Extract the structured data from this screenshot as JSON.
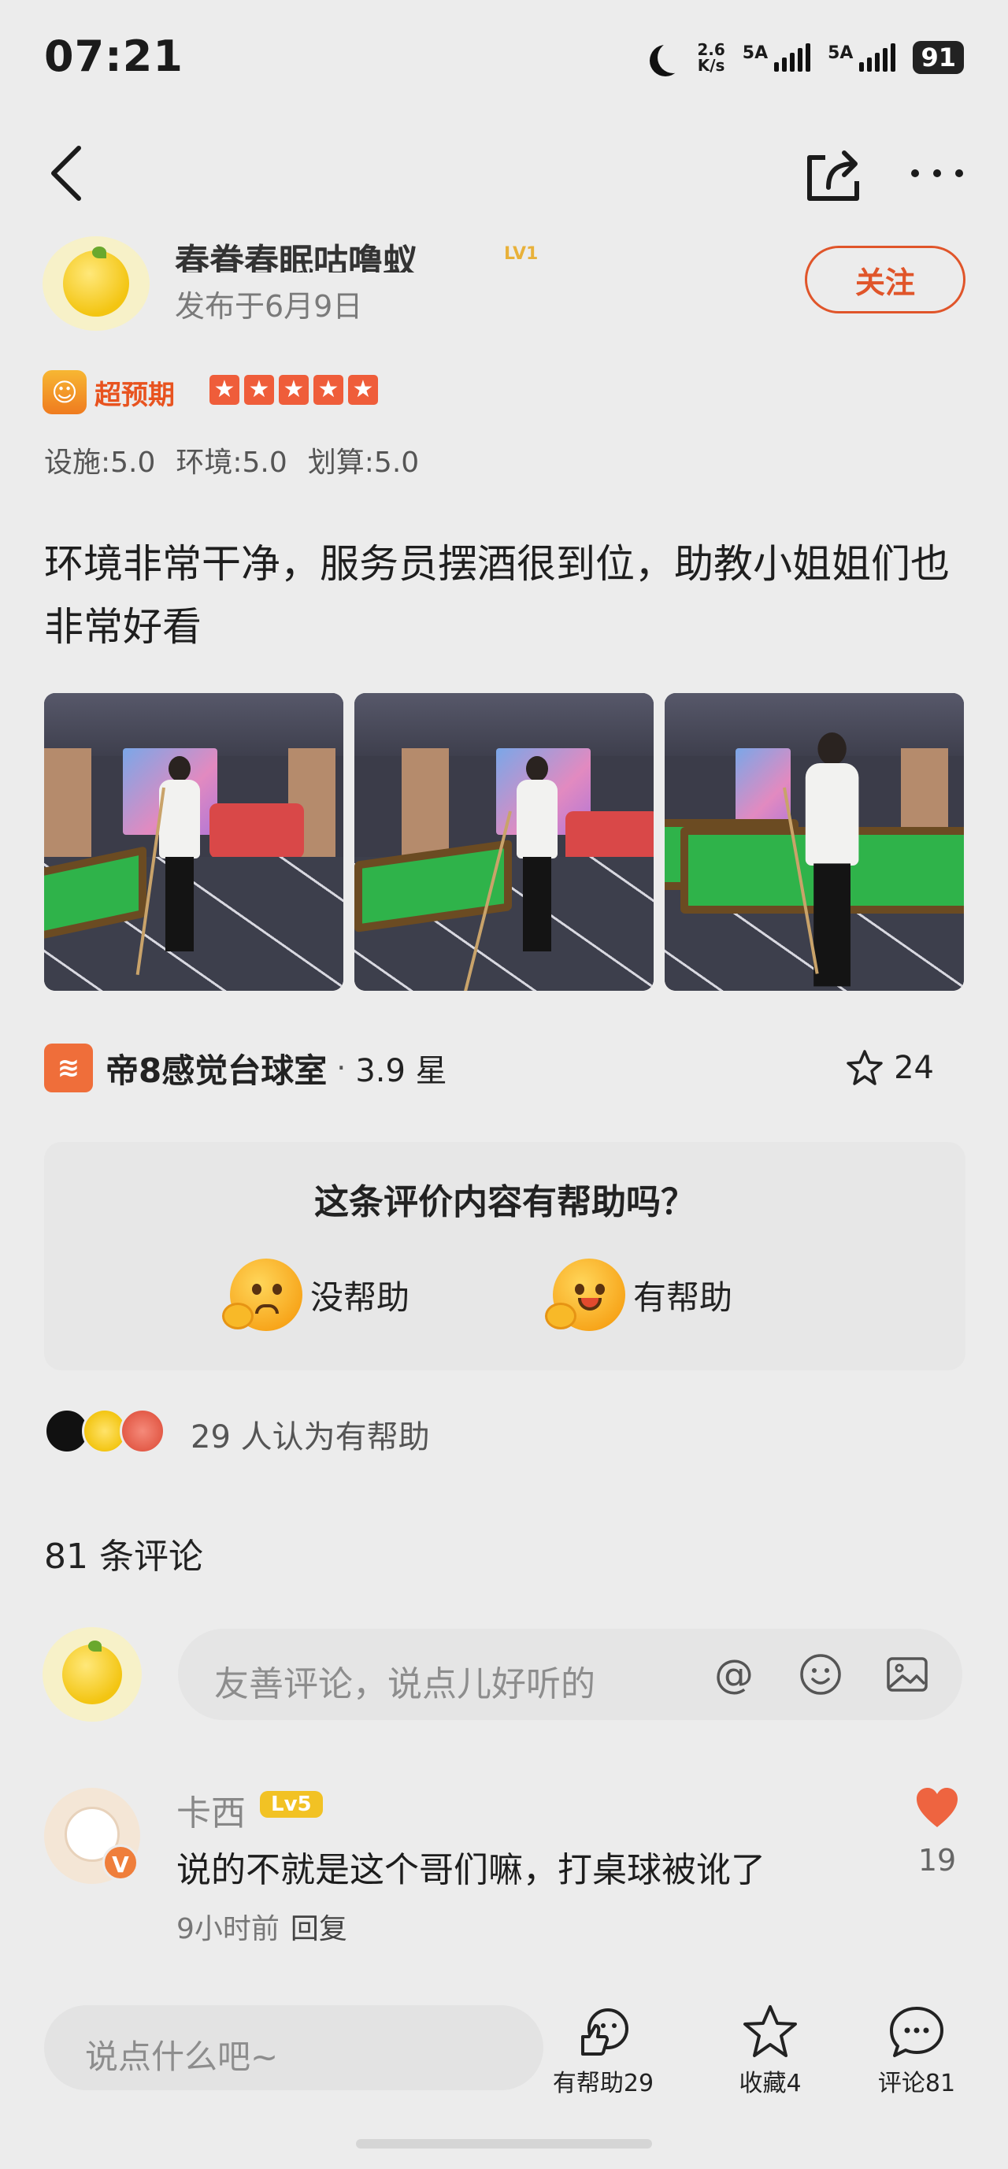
{
  "status_bar": {
    "time": "07:21",
    "net_speed_value": "2.6",
    "net_speed_unit": "K/s",
    "sim1": "5A",
    "sim2": "5A",
    "battery": "91"
  },
  "nav": {
    "back_icon": "chevron-left-icon",
    "share_icon": "share-icon",
    "more_icon": "more-dots-icon"
  },
  "author": {
    "name": "春眷春眠咕噜蚁",
    "level": "LV1",
    "date": "发布于6月9日",
    "follow_label": "关注"
  },
  "rating": {
    "badge": "超预期",
    "stars": 5,
    "scores": [
      "设施:5.0",
      "环境:5.0",
      "划算:5.0"
    ]
  },
  "review_text": "环境非常干净，服务员摆酒很到位，助教小姐姐们也非常好看",
  "photos": [
    "billiards-photo-1",
    "billiards-photo-2",
    "billiards-photo-3"
  ],
  "shop": {
    "icon_letter": "≋",
    "name": "帝8感觉台球室",
    "dot": "·",
    "rating": "3.9 星",
    "fav_count": "24"
  },
  "helpful_card": {
    "question": "这条评价内容有帮助吗？",
    "no_label": "没帮助",
    "yes_label": "有帮助"
  },
  "helpful_summary": "29 人认为有帮助",
  "comments_count": "81 条评论",
  "comment_input": {
    "placeholder": "友善评论，说点儿好听的"
  },
  "comment": {
    "name": "卡西",
    "level": "Lv5",
    "badge": "V",
    "text": "说的不就是这个哥们嘛，打桌球被讹了",
    "time": "9小时前",
    "reply": "回复",
    "likes": "19"
  },
  "bottom_bar": {
    "input_placeholder": "说点什么吧~",
    "helpful_label": "有帮助29",
    "collect_label": "收藏4",
    "comment_label": "评论81"
  },
  "colors": {
    "accent": "#e0552a",
    "background": "#ececec",
    "heart": "#ee6440",
    "badge_yellow": "#f2c224"
  }
}
